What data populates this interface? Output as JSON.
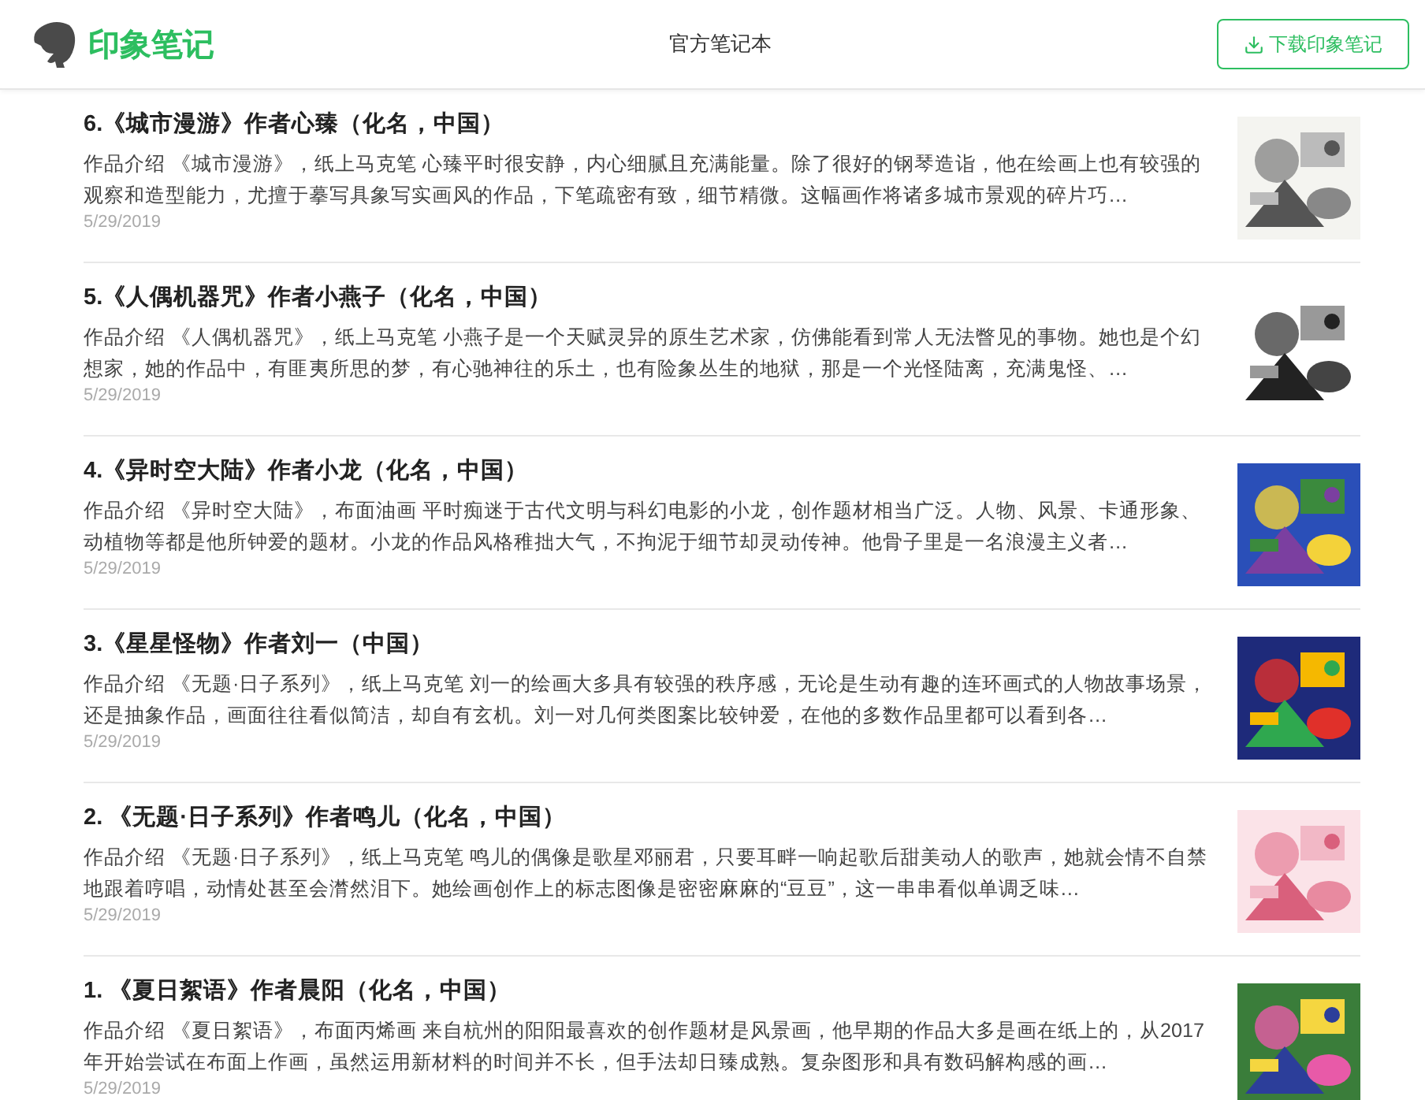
{
  "header": {
    "brand": "印象笔记",
    "title": "官方笔记本",
    "download_button": "下载印象笔记"
  },
  "notes": [
    {
      "title": "6.《城市漫游》作者心臻（化名，中国）",
      "summary": "作品介绍 《城市漫游》，纸上马克笔 心臻平时很安静，内心细腻且充满能量。除了很好的钢琴造诣，他在绘画上也有较强的观察和造型能力，尤擅于摹写具象写实画风的作品，下笔疏密有致，细节精微。这幅画作将诸多城市景观的碎片巧…",
      "date": "5/29/2019"
    },
    {
      "title": "5.《人偶机器咒》作者小燕子（化名，中国）",
      "summary": "作品介绍 《人偶机器咒》，纸上马克笔 小燕子是一个天赋灵异的原生艺术家，仿佛能看到常人无法瞥见的事物。她也是个幻想家，她的作品中，有匪夷所思的梦，有心驰神往的乐土，也有险象丛生的地狱，那是一个光怪陆离，充满鬼怪、…",
      "date": "5/29/2019"
    },
    {
      "title": "4.《异时空大陆》作者小龙（化名，中国）",
      "summary": "作品介绍 《异时空大陆》，布面油画 平时痴迷于古代文明与科幻电影的小龙，创作题材相当广泛。人物、风景、卡通形象、动植物等都是他所钟爱的题材。小龙的作品风格稚拙大气，不拘泥于细节却灵动传神。他骨子里是一名浪漫主义者…",
      "date": "5/29/2019"
    },
    {
      "title": "3.《星星怪物》作者刘一（中国）",
      "summary": "作品介绍 《无题·日子系列》，纸上马克笔 刘一的绘画大多具有较强的秩序感，无论是生动有趣的连环画式的人物故事场景，还是抽象作品，画面往往看似简洁，却自有玄机。刘一对几何类图案比较钟爱，在他的多数作品里都可以看到各…",
      "date": "5/29/2019"
    },
    {
      "title": "2. 《无题·日子系列》作者鸣儿（化名，中国）",
      "summary": "作品介绍 《无题·日子系列》，纸上马克笔 鸣儿的偶像是歌星邓丽君，只要耳畔一响起歌后甜美动人的歌声，她就会情不自禁地跟着哼唱，动情处甚至会潸然泪下。她绘画创作上的标志图像是密密麻麻的“豆豆”，这一串串看似单调乏味…",
      "date": "5/29/2019"
    },
    {
      "title": "1. 《夏日絮语》作者晨阳（化名，中国）",
      "summary": "作品介绍 《夏日絮语》，布面丙烯画 来自杭州的阳阳最喜欢的创作题材是风景画，他早期的作品大多是画在纸上的，从2017年开始尝试在布面上作画，虽然运用新材料的时间并不长，但手法却日臻成熟。复杂图形和具有数码解构感的画…",
      "date": "5/29/2019"
    }
  ]
}
